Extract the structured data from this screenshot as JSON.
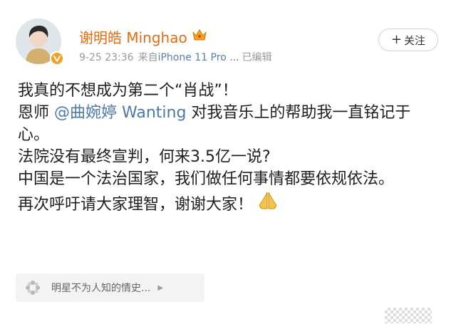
{
  "header": {
    "username": "谢明皓 Minghao",
    "timestamp": "9-25 23:36",
    "source_prefix": "来自",
    "device": "iPhone 11 Pro ...",
    "edited": "已编辑",
    "follow_label": "关注"
  },
  "post": {
    "line1": "我真的不想成为第二个“肖战”！",
    "line2_prefix": "恩师 ",
    "mention": "@曲婉婷 Wanting",
    "line2_suffix": " 对我音乐上的帮助我一直铭记于心。",
    "line3": "法院没有最终宣判，何来3.5亿一说?",
    "line4": "中国是一个法治国家，我们做任何事情都要依规依法。",
    "line5": "再次呼吁请大家理智，谢谢大家！"
  },
  "topic": {
    "label": "明星不为人知的情史..."
  },
  "colors": {
    "username": "#e86b0f",
    "mention": "#4a79a8",
    "meta": "#9a9a9a",
    "vip_badge": "#f2a020"
  },
  "icons": {
    "crown": "crown-icon",
    "verified": "verified-badge-icon",
    "pray": "pray-icon",
    "topic": "flower-icon",
    "caret": "caret-right-icon"
  }
}
